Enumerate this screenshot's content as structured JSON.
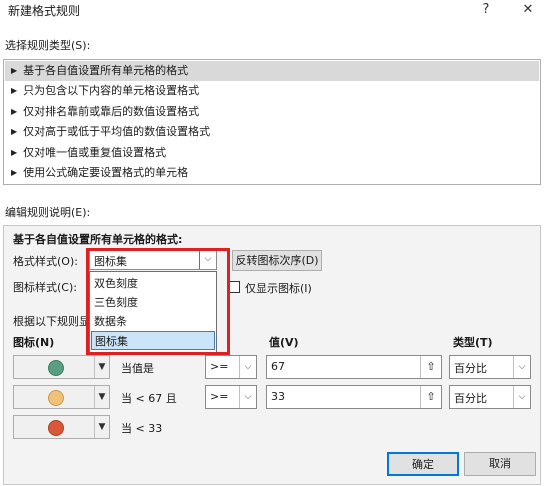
{
  "window": {
    "title": "新建格式规则",
    "help_glyph": "?",
    "close_glyph": "✕"
  },
  "select_rule_type": {
    "label": "选择规则类型(S):",
    "items": [
      {
        "label": "基于各自值设置所有单元格的格式",
        "selected": true
      },
      {
        "label": "只为包含以下内容的单元格设置格式"
      },
      {
        "label": "仅对排名靠前或靠后的数值设置格式"
      },
      {
        "label": "仅对高于或低于平均值的数值设置格式"
      },
      {
        "label": "仅对唯一值或重复值设置格式"
      },
      {
        "label": "使用公式确定要设置格式的单元格"
      }
    ]
  },
  "edit_rule": {
    "label": "编辑规则说明(E):",
    "heading": "基于各自值设置所有单元格的格式:",
    "format_style_label": "格式样式(O):",
    "format_style_value": "图标集",
    "reverse_button": "反转图标次序(D)",
    "icon_style_label": "图标样式(C):",
    "show_icon_only_label": "仅显示图标(I)",
    "rules_label": "根据以下规则显",
    "dropdown_options": [
      "双色刻度",
      "三色刻度",
      "数据条",
      "图标集"
    ],
    "dropdown_selected_index": 3,
    "columns": {
      "icon": "图标(N)",
      "value": "值(V)",
      "type": "类型(T)"
    },
    "rows": [
      {
        "icon_color": "#5a9e82",
        "condition": "当值是",
        "operator": ">=",
        "value": "67",
        "type": "百分比"
      },
      {
        "icon_color": "#efc27a",
        "condition": "当 < 67 且",
        "operator": ">=",
        "value": "33",
        "type": "百分比"
      },
      {
        "icon_color": "#d9583a",
        "condition": "当 < 33"
      }
    ]
  },
  "buttons": {
    "ok": "确定",
    "cancel": "取消"
  },
  "colors": {
    "highlight_box": "#e02020",
    "dropdown_selection": "#cce4f7"
  }
}
